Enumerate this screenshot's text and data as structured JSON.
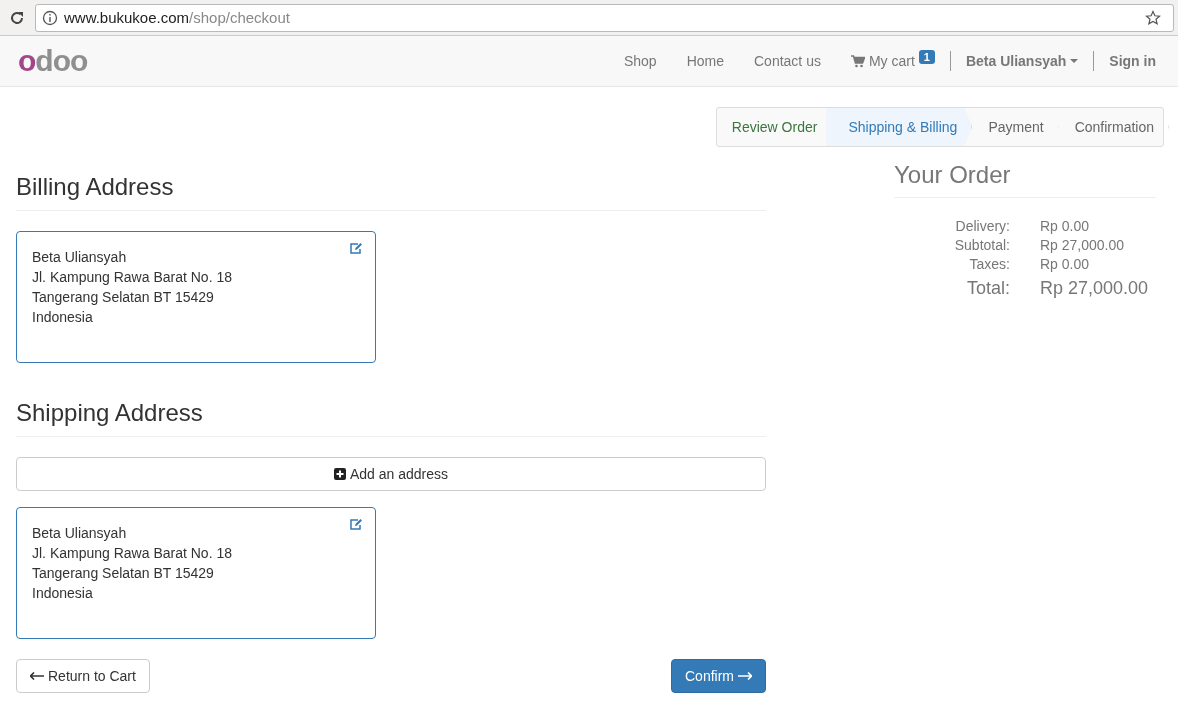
{
  "browser": {
    "url_host": "www.bukukoe.com",
    "url_path": "/shop/checkout"
  },
  "navbar": {
    "logo": "odoo",
    "links": [
      "Shop",
      "Home",
      "Contact us"
    ],
    "cart": {
      "label": "My cart",
      "count": "1"
    },
    "user": "Beta Uliansyah",
    "sign_in": "Sign in"
  },
  "steps": [
    {
      "label": "Review Order",
      "kind": "done"
    },
    {
      "label": "Shipping & Billing",
      "kind": "current"
    },
    {
      "label": "Payment",
      "kind": "todo"
    },
    {
      "label": "Confirmation",
      "kind": "todo"
    }
  ],
  "billing": {
    "title": "Billing Address",
    "address": [
      "Beta Uliansyah",
      "Jl. Kampung Rawa Barat No. 18",
      "Tangerang Selatan BT 15429",
      "Indonesia"
    ]
  },
  "shipping": {
    "title": "Shipping Address",
    "add_button": "Add an address",
    "address": [
      "Beta Uliansyah",
      "Jl. Kampung Rawa Barat No. 18",
      "Tangerang Selatan BT 15429",
      "Indonesia"
    ]
  },
  "buttons": {
    "back": "Return to Cart",
    "confirm": "Confirm"
  },
  "order": {
    "title": "Your Order",
    "lines": [
      {
        "label": "Delivery:",
        "value": "Rp 0.00"
      },
      {
        "label": "Subtotal:",
        "value": "Rp 27,000.00"
      },
      {
        "label": "Taxes:",
        "value": "Rp 0.00"
      }
    ],
    "total": {
      "label": "Total:",
      "value": "Rp 27,000.00"
    }
  }
}
